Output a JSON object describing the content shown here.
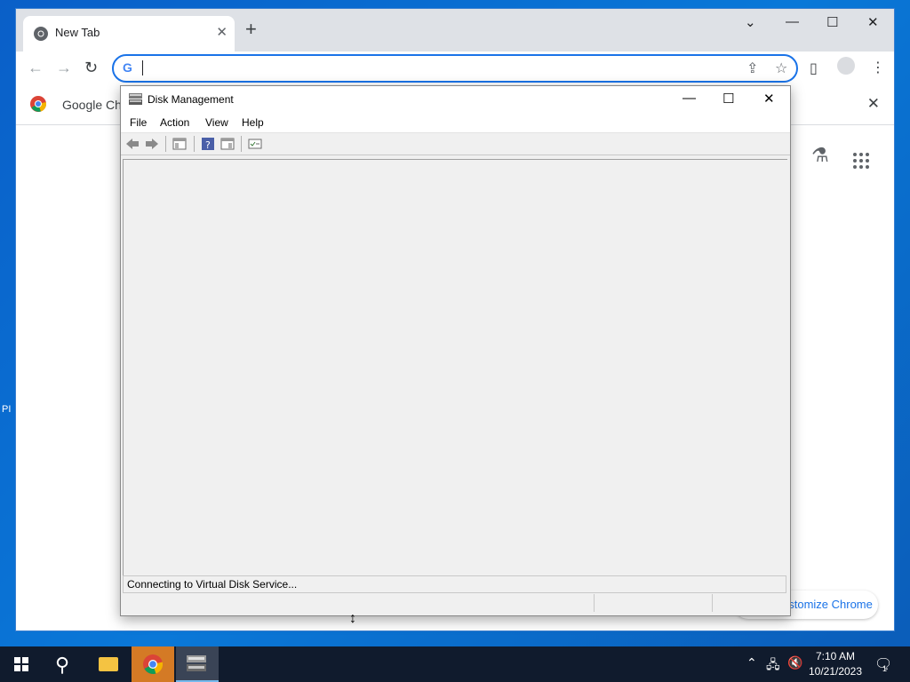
{
  "desktop": {
    "edge_text": "PI"
  },
  "chrome": {
    "tab_title": "New Tab",
    "new_tab_symbol": "+",
    "minimize": "—",
    "maximize": "☐",
    "close": "✕",
    "dropdown": "⌄",
    "omnibox_value": "",
    "bookmark_text": "Google Chr",
    "customize_label": "ustomize Chrome"
  },
  "disk_management": {
    "title": "Disk Management",
    "menus": [
      "File",
      "Action",
      "View",
      "Help"
    ],
    "status_text": "Connecting to Virtual Disk Service..."
  },
  "taskbar": {
    "time": "7:10 AM",
    "date": "10/21/2023",
    "notification_count": "1"
  },
  "icons": {
    "chrome_tab": "chrome-logo-icon",
    "labs": "labs-flask-icon",
    "apps": "apps-grid-icon",
    "search": "search-icon"
  },
  "colors": {
    "desktop": "#0a78d8",
    "chrome_accent": "#1a73e8",
    "taskbar": "#101b2d",
    "active_taskbar": "#d47a25"
  }
}
